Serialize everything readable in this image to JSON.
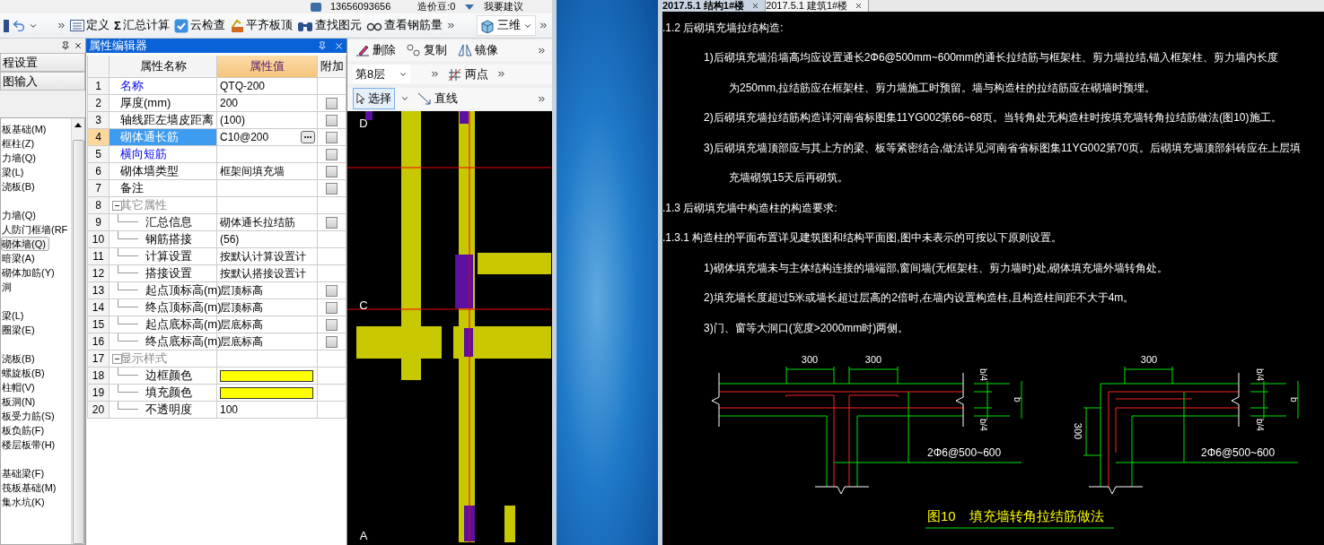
{
  "top_bar": {
    "phone": "13656093656",
    "beans": "造价豆:0",
    "feedback": "我要建议"
  },
  "toolbar": {
    "items": [
      {
        "label": "定义"
      },
      {
        "label": "汇总计算",
        "glyph": "Σ"
      },
      {
        "label": "云检查"
      },
      {
        "label": "平齐板顶"
      },
      {
        "label": "查找图元"
      },
      {
        "label": "查看钢筋量"
      }
    ],
    "view_button": "三维"
  },
  "sidebar": {
    "tabs": [
      "程设置",
      "图输入"
    ],
    "groups": [
      [
        {
          "label": "板基础(M)",
          "selected": false
        },
        {
          "label": "框柱(Z)",
          "selected": false
        },
        {
          "label": "力墙(Q)",
          "selected": false
        },
        {
          "label": "梁(L)",
          "selected": false
        },
        {
          "label": "浇板(B)",
          "selected": false
        }
      ],
      [
        {
          "label": "力墙(Q)",
          "selected": false
        },
        {
          "label": "人防门框墙(RF",
          "selected": false
        },
        {
          "label": "砌体墙(Q)",
          "selected": true
        },
        {
          "label": "暗梁(A)",
          "selected": false
        },
        {
          "label": "砌体加筋(Y)",
          "selected": false
        },
        {
          "label": "洞",
          "selected": false
        }
      ],
      [
        {
          "label": "梁(L)",
          "selected": false
        },
        {
          "label": "圈梁(E)",
          "selected": false
        }
      ],
      [
        {
          "label": "浇板(B)",
          "selected": false
        },
        {
          "label": "螺旋板(B)",
          "selected": false
        },
        {
          "label": "柱帽(V)",
          "selected": false
        },
        {
          "label": "板洞(N)",
          "selected": false
        },
        {
          "label": "板受力筋(S)",
          "selected": false
        },
        {
          "label": "板负筋(F)",
          "selected": false
        },
        {
          "label": "楼层板带(H)",
          "selected": false
        }
      ],
      [
        {
          "label": "基础梁(F)",
          "selected": false
        },
        {
          "label": "筏板基础(M)",
          "selected": false
        },
        {
          "label": "集水坑(K)",
          "selected": false
        }
      ]
    ]
  },
  "property_editor": {
    "title": "属性编辑器",
    "columns": [
      "属性名称",
      "属性值",
      "附加"
    ],
    "rows": [
      {
        "num": "1",
        "name": "名称",
        "value": "QTQ-200",
        "emphasized": true,
        "selected": false
      },
      {
        "num": "2",
        "name": "厚度(mm)",
        "value": "200",
        "emphasized": false,
        "selected": false,
        "checked": false
      },
      {
        "num": "3",
        "name": "轴线距左墙皮距离",
        "value": "(100)",
        "emphasized": false,
        "selected": false,
        "checked": false
      },
      {
        "num": "4",
        "name": "砌体通长筋",
        "value": "C10@200",
        "emphasized": false,
        "selected": true,
        "checked": false
      },
      {
        "num": "5",
        "name": "横向短筋",
        "emphasized": true,
        "selected": false,
        "checked": false
      },
      {
        "num": "6",
        "name": "砌体墙类型",
        "value": "框架间填充墙",
        "emphasized": false,
        "selected": false,
        "checked": false
      },
      {
        "num": "7",
        "name": "备注",
        "emphasized": false,
        "selected": false,
        "checked": false
      },
      {
        "num": "8",
        "name": "其它属性",
        "kind": "group",
        "expanded": true,
        "selected": false,
        "children": [
          {
            "num": "9",
            "name": "汇总信息",
            "value": "砌体通长拉结筋",
            "emphasized": false,
            "selected": false,
            "checked": false
          },
          {
            "num": "10",
            "name": "钢筋搭接",
            "value": "(56)",
            "emphasized": false,
            "selected": false
          },
          {
            "num": "11",
            "name": "计算设置",
            "value": "按默认计算设置计",
            "emphasized": false,
            "selected": false
          },
          {
            "num": "12",
            "name": "搭接设置",
            "value": "按默认搭接设置计",
            "emphasized": false,
            "selected": false
          },
          {
            "num": "13",
            "name": "起点顶标高(m)",
            "value": "层顶标高",
            "emphasized": false,
            "selected": false,
            "checked": false
          },
          {
            "num": "14",
            "name": "终点顶标高(m)",
            "value": "层顶标高",
            "emphasized": false,
            "selected": false,
            "checked": false
          },
          {
            "num": "15",
            "name": "起点底标高(m)",
            "value": "层底标高",
            "emphasized": false,
            "selected": false,
            "checked": false
          },
          {
            "num": "16",
            "name": "终点底标高(m)",
            "value": "层底标高",
            "emphasized": false,
            "selected": false,
            "checked": false
          }
        ]
      },
      {
        "num": "17",
        "name": "显示样式",
        "kind": "group",
        "expanded": true,
        "selected": false,
        "children": [
          {
            "num": "18",
            "name": "边框颜色",
            "color": "#ffff00",
            "emphasized": false,
            "selected": false
          },
          {
            "num": "19",
            "name": "填充颜色",
            "color": "#ffff00",
            "emphasized": false,
            "selected": false
          },
          {
            "num": "20",
            "name": "不透明度",
            "value": "100",
            "emphasized": false,
            "selected": false
          }
        ]
      }
    ]
  },
  "canvas": {
    "edit_buttons": [
      "删除",
      "复制",
      "镜像"
    ],
    "floor": "第8层",
    "point_button": "两点",
    "select_button": "选择",
    "line_button": "直线",
    "axis_labels": [
      "D",
      "C",
      "A"
    ]
  },
  "document": {
    "tabs": [
      {
        "label": "2017.5.1  结构1#楼",
        "selected": true
      },
      {
        "label": "2017.5.1  建筑1#楼",
        "selected": false
      }
    ],
    "lines": [
      {
        "kind": "heading",
        "text": ".1.2  后砌填充墙拉结构造:"
      },
      {
        "kind": "item",
        "text": "1)后砌填充墙沿墙高均应设置通长2Φ6@500mm~600mm的通长拉结筋与框架柱、剪力墙拉结,锚入框架柱、剪力墙内长度"
      },
      {
        "kind": "continuation",
        "text": "为250mm,拉结筋应在框架柱、剪力墙施工时预留。墙与构造柱的拉结筋应在砌墙时预埋。"
      },
      {
        "kind": "item",
        "text": "2)后砌填充墙拉结筋构造详河南省标图集11YG002第66~68页。当转角处无构造柱时按填充墙转角拉结筋做法(图10)施工。"
      },
      {
        "kind": "item",
        "text": "3)后砌填充墙顶部应与其上方的梁、板等紧密结合,做法详见河南省省标图集11YG002第70页。后砌填充墙顶部斜砖应在上层填"
      },
      {
        "kind": "continuation",
        "text": "充墙砌筑15天后再砌筑。"
      },
      {
        "kind": "heading",
        "text": ".1.3  后砌填充墙中构造柱的构造要求:"
      },
      {
        "kind": "heading",
        "text": ".1.3.1  构造柱的平面布置详见建筑图和结构平面图,图中未表示的可按以下原则设置。"
      },
      {
        "kind": "item",
        "text": "1)砌体填充墙未与主体结构连接的墙端部,窗间墙(无框架柱、剪力墙时)处,砌体填充墙外墙转角处。"
      },
      {
        "kind": "item",
        "text": "2)填充墙长度超过5米或墙长超过层高的2倍时,在墙内设置构造柱,且构造柱间距不大于4m。"
      },
      {
        "kind": "item",
        "text": "3)门、窗等大洞口(宽度>2000mm时)两侧。"
      }
    ],
    "figure": {
      "number": "图10",
      "caption": "填充墙转角拉结筋做法",
      "details": [
        {
          "kind": "t-junction",
          "dims": [
            "300",
            "300"
          ],
          "side_dims": [
            "b/4",
            "b",
            "b/4"
          ],
          "rebar_note": "2Φ6@500~600"
        },
        {
          "kind": "corner",
          "dims": [
            "300"
          ],
          "height_dim": "300",
          "side_dims": [
            "b/4",
            "b",
            "b/4"
          ],
          "rebar_note": "2Φ6@500~600"
        }
      ]
    }
  }
}
